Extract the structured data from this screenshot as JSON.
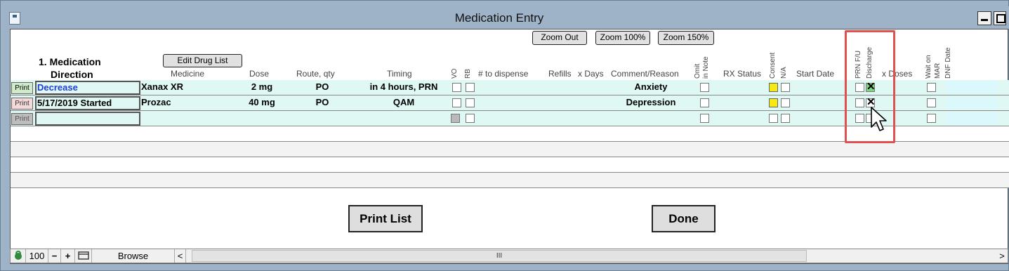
{
  "window": {
    "title": "Medication Entry"
  },
  "toolbar": {
    "zoom_out": "Zoom Out",
    "zoom_100": "Zoom 100%",
    "zoom_150": "Zoom 150%",
    "edit_drug_list": "Edit Drug List"
  },
  "headers": {
    "title_line1": "1. Medication",
    "title_line2": "Direction",
    "medicine": "Medicine",
    "dose": "Dose",
    "route": "Route, qty",
    "timing": "Timing",
    "vo": "VO",
    "rb": "RB",
    "to_dispense": "# to dispense",
    "refills": "Refills",
    "x_days": "x Days",
    "comment": "Comment/Reason",
    "omit_line1": "Omit",
    "omit_line2": "in Note",
    "rx_status": "RX Status",
    "consent": "Consent",
    "na": "N/A",
    "start_date": "Start Date",
    "prn_fu": "PRN F/U",
    "discharge": "Discharge",
    "x_doses": "x Doses",
    "wait_on": "Wait on",
    "mar": "MAR",
    "dnf_date": "DNF Date"
  },
  "rows": [
    {
      "print": "Print",
      "direction": "Decrease",
      "medicine": "Xanax XR",
      "dose": "2 mg",
      "route": "PO",
      "timing": "in 4 hours, PRN",
      "comment": "Anxiety",
      "discharge_checked": true
    },
    {
      "print": "Print",
      "direction": "5/17/2019 Started",
      "medicine": "Prozac",
      "dose": "40 mg",
      "route": "PO",
      "timing": "QAM",
      "comment": "Depression",
      "discharge_checked": true
    },
    {
      "print": "Print",
      "direction": "",
      "medicine": "",
      "dose": "",
      "route": "",
      "timing": "",
      "comment": "",
      "discharge_checked": false
    }
  ],
  "buttons": {
    "print_list": "Print List",
    "done": "Done"
  },
  "statusbar": {
    "zoom": "100",
    "mode": "Browse",
    "scroll_grip": "III"
  },
  "colors": {
    "row_fill": "#dff8f3",
    "consent_yellow": "#f7ea13",
    "highlight_red": "#e05050",
    "direction_blue": "#1f3ed8"
  }
}
